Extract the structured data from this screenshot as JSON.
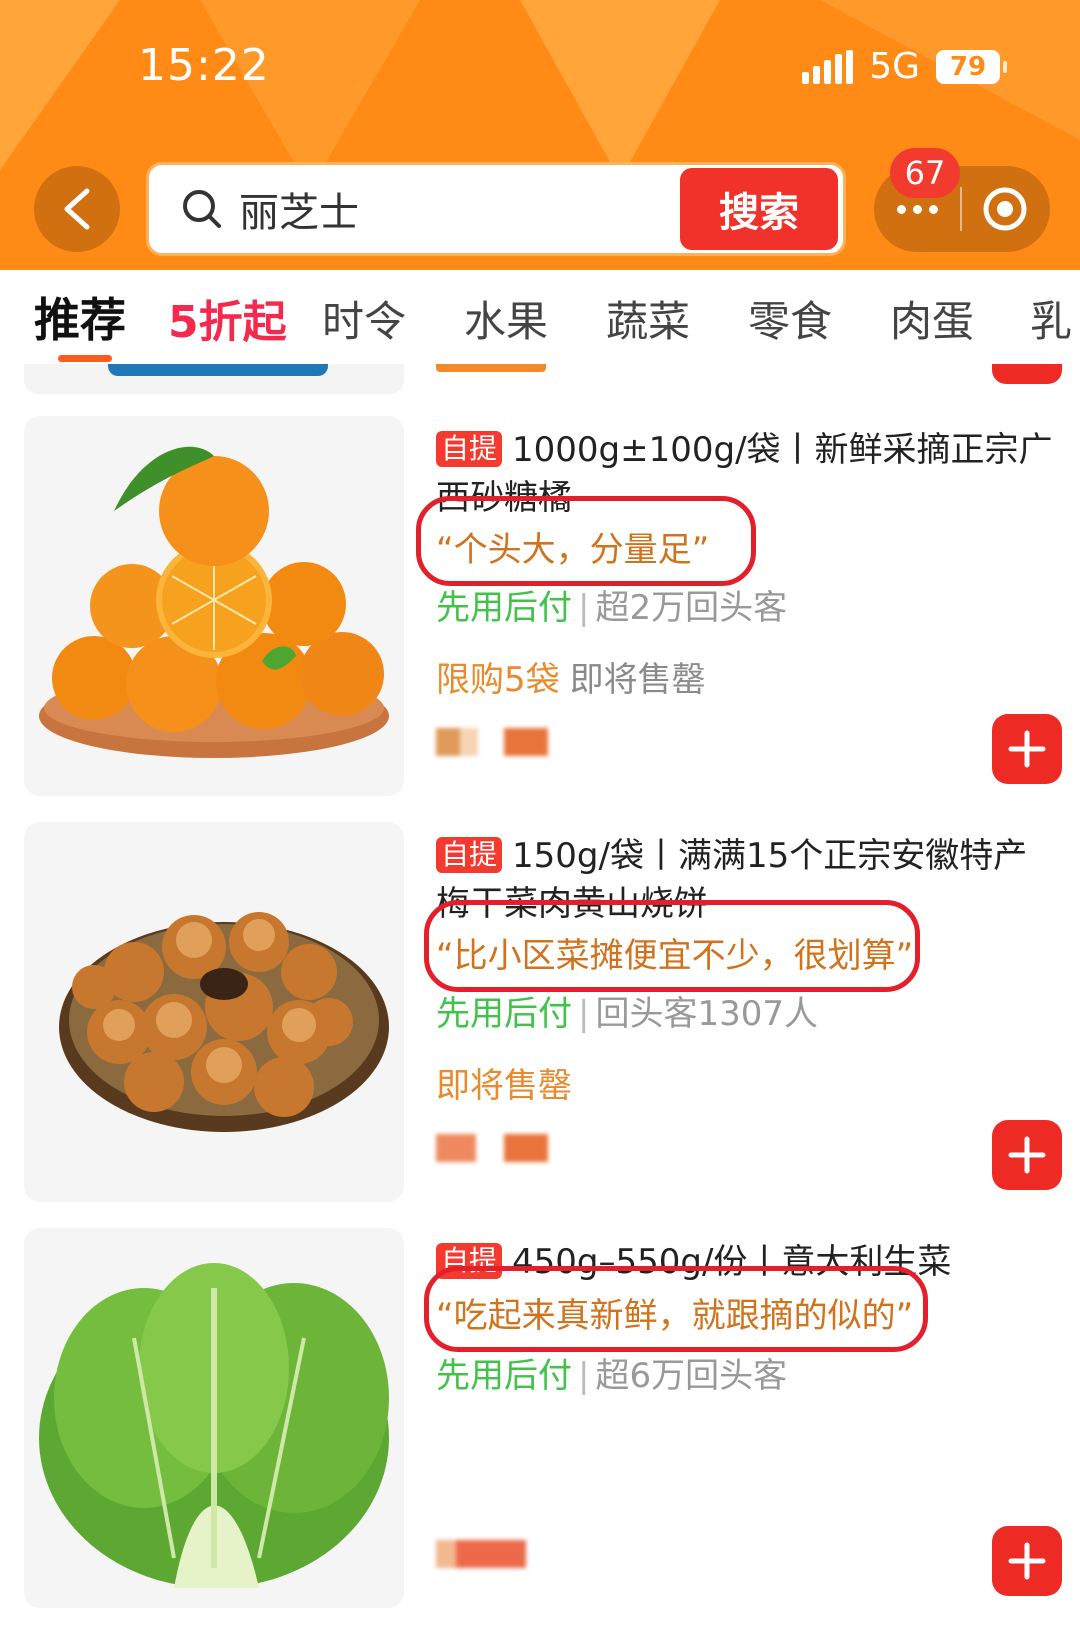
{
  "status_bar": {
    "time": "15:22",
    "network": "5G",
    "battery": "79"
  },
  "header": {
    "search_query": "丽芝士",
    "search_button": "搜索",
    "notification_count": "67"
  },
  "tabs": [
    {
      "label": "推荐"
    },
    {
      "label": "5折起"
    },
    {
      "label": "时令"
    },
    {
      "label": "水果"
    },
    {
      "label": "蔬菜"
    },
    {
      "label": "零食"
    },
    {
      "label": "肉蛋"
    },
    {
      "label": "乳"
    }
  ],
  "products": [
    {
      "tag": "自提",
      "title": "1000g±100g/袋丨新鲜采摘正宗广西砂糖橘",
      "quote": "“个头大，分量足”",
      "pay_label": "先用后付",
      "repeat_customers": "超2万回头客",
      "limit": "限购5袋",
      "stock_status": "即将售罄"
    },
    {
      "tag": "自提",
      "title": "150g/袋丨满满15个正宗安徽特产梅干菜肉黄山烧饼",
      "quote": "“比小区菜摊便宜不少，很划算”",
      "pay_label": "先用后付",
      "repeat_customers": "回头客1307人",
      "stock_status": "即将售罄"
    },
    {
      "tag": "自提",
      "title": "450g–550g/份丨意大利生菜",
      "quote": "“吃起来真新鲜，就跟摘的似的”",
      "pay_label": "先用后付",
      "repeat_customers": "超6万回头客"
    }
  ],
  "colors": {
    "header_orange": "#ff8a16",
    "search_red": "#f0322b",
    "promo_pink": "#f3294d",
    "quote_orange": "#d0731c",
    "highlight_frame_red": "#e31f2b",
    "pay_green": "#41c24b",
    "add_red": "#ee2a24"
  }
}
